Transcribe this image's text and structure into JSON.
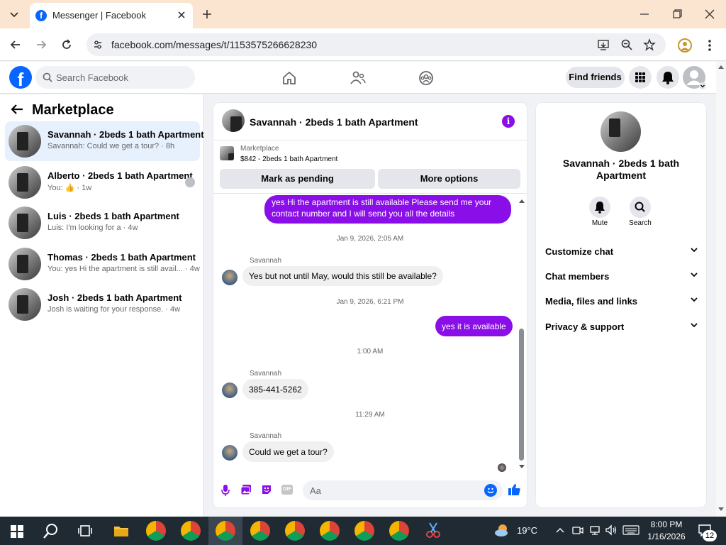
{
  "browser": {
    "tab_title": "Messenger | Facebook",
    "url": "facebook.com/messages/t/1153575266628230"
  },
  "fb": {
    "search_placeholder": "Search Facebook",
    "find_friends": "Find friends"
  },
  "left": {
    "title": "Marketplace",
    "conversations": [
      {
        "title": "Savannah · 2beds 1 bath Apartment",
        "subtitle": "Savannah: Could we get a tour? · 8h",
        "active": true
      },
      {
        "title": "Alberto · 2beds 1 bath Apartment",
        "subtitle": "You: 👍 · 1w",
        "active": false
      },
      {
        "title": "Luis · 2beds 1 bath Apartment",
        "subtitle": "Luis: I'm looking for a · 4w",
        "active": false
      },
      {
        "title": "Thomas · 2beds 1 bath Apartment",
        "subtitle": "You: yes Hi the apartment is still avail... · 4w",
        "active": false
      },
      {
        "title": "Josh · 2beds 1 bath Apartment",
        "subtitle": "Josh is waiting for your response. · 4w",
        "active": false
      }
    ]
  },
  "chat": {
    "title": "Savannah · 2beds 1 bath Apartment",
    "listing_label": "Marketplace",
    "listing_detail": "$842 - 2beds 1 bath Apartment",
    "mark_pending": "Mark as pending",
    "more_options": "More options",
    "messages": {
      "m1": "yes Hi the apartment is still available Please send me your contact number and I will send you all the details",
      "t1": "Jan 9, 2026, 2:05 AM",
      "s1": "Savannah",
      "m2": "Yes but not until May, would this still be available?",
      "t2": "Jan 9, 2026, 6:21 PM",
      "m3": "yes it is available",
      "t3": "1:00 AM",
      "s2": "Savannah",
      "m4": "385-441-5262",
      "t4": "11:29 AM",
      "s3": "Savannah",
      "m5": "Could we get a tour?"
    },
    "composer_placeholder": "Aa"
  },
  "right": {
    "name": "Savannah · 2beds 1 bath Apartment",
    "mute": "Mute",
    "search": "Search",
    "items": [
      "Customize chat",
      "Chat members",
      "Media, files and links",
      "Privacy & support"
    ]
  },
  "taskbar": {
    "weather": "19°C",
    "time": "8:00 PM",
    "date": "1/16/2026",
    "notifications": "12"
  },
  "colors": {
    "accent": "#8a0ee8",
    "fb_blue": "#0866ff"
  }
}
